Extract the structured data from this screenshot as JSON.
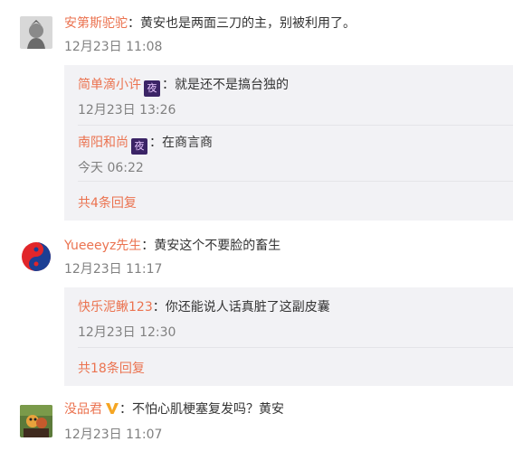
{
  "colors": {
    "name": "#eb7350",
    "time": "#808080",
    "reply_bg": "#f2f2f5",
    "text": "#333333"
  },
  "separator": "：",
  "comments": [
    {
      "user": "安第斯驼驼",
      "text": "黄安也是两面三刀的主，别被利用了。",
      "time": "12月23日 11:08",
      "avatar_icon": "warrior-statue-avatar",
      "replies": [
        {
          "user": "简单滴小许",
          "badge": "夜",
          "text": "就是还不是搞台独的",
          "time": "12月23日 13:26"
        },
        {
          "user": "南阳和尚",
          "badge": "夜",
          "text": "在商言商",
          "time": "今天 06:22"
        }
      ],
      "more_label": "共4条回复"
    },
    {
      "user": "Yueeeyz先生",
      "text": "黄安这个不要脸的畜生",
      "time": "12月23日 11:17",
      "avatar_icon": "taiji-yin-yang-avatar",
      "replies": [
        {
          "user": "快乐泥鳅123",
          "text": "你还能说人话真脏了这副皮囊",
          "time": "12月23日 12:30"
        }
      ],
      "more_label": "共18条回复"
    },
    {
      "user": "没品君",
      "verified_icon": "orange-v-badge-icon",
      "text": "不怕心肌梗塞复发吗？黄安",
      "time": "12月23日 11:07",
      "avatar_icon": "colorful-photo-avatar"
    }
  ]
}
